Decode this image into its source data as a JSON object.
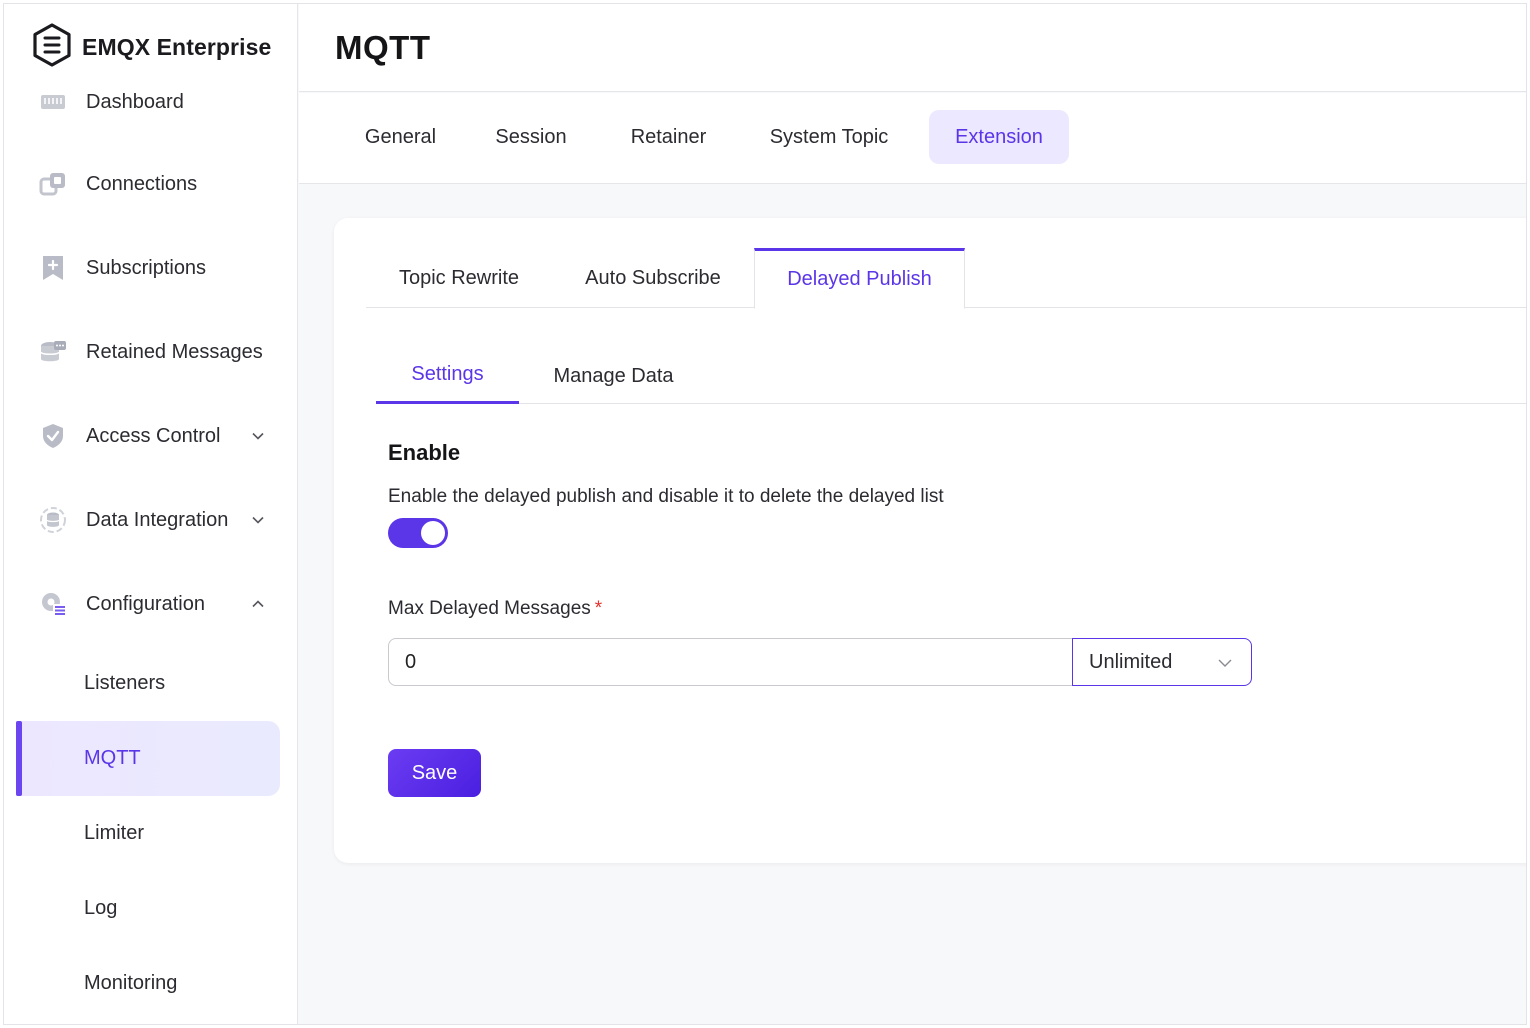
{
  "brand": {
    "name": "EMQX Enterprise"
  },
  "sidebar": {
    "items": [
      {
        "label": "Dashboard",
        "icon": "dashboard-icon"
      },
      {
        "label": "Connections",
        "icon": "connections-icon"
      },
      {
        "label": "Subscriptions",
        "icon": "subscriptions-icon"
      },
      {
        "label": "Retained Messages",
        "icon": "retained-messages-icon"
      },
      {
        "label": "Access Control",
        "icon": "shield-icon",
        "expandable": true,
        "expanded": false
      },
      {
        "label": "Data Integration",
        "icon": "data-integration-icon",
        "expandable": true,
        "expanded": false
      },
      {
        "label": "Configuration",
        "icon": "gear-icon",
        "expandable": true,
        "expanded": true
      }
    ],
    "sub_items": [
      {
        "label": "Listeners",
        "active": false
      },
      {
        "label": "MQTT",
        "active": true
      },
      {
        "label": "Limiter",
        "active": false
      },
      {
        "label": "Log",
        "active": false
      },
      {
        "label": "Monitoring",
        "active": false
      }
    ]
  },
  "header": {
    "title": "MQTT"
  },
  "top_tabs": [
    {
      "label": "General",
      "active": false
    },
    {
      "label": "Session",
      "active": false
    },
    {
      "label": "Retainer",
      "active": false
    },
    {
      "label": "System Topic",
      "active": false
    },
    {
      "label": "Extension",
      "active": true
    }
  ],
  "extension_tabs": [
    {
      "label": "Topic Rewrite",
      "active": false
    },
    {
      "label": "Auto Subscribe",
      "active": false
    },
    {
      "label": "Delayed Publish",
      "active": true
    }
  ],
  "delayed_tabs": [
    {
      "label": "Settings",
      "active": true
    },
    {
      "label": "Manage Data",
      "active": false
    }
  ],
  "form": {
    "enable_title": "Enable",
    "enable_description": "Enable the delayed publish and disable it to delete the delayed list",
    "enable_value": true,
    "max_label": "Max Delayed Messages",
    "required_mark": "*",
    "max_value": "0",
    "max_unit_selected": "Unlimited",
    "save_label": "Save"
  },
  "colors": {
    "accent": "#5b35e8",
    "accent_light": "#ece8ff",
    "required": "#e5322d"
  }
}
